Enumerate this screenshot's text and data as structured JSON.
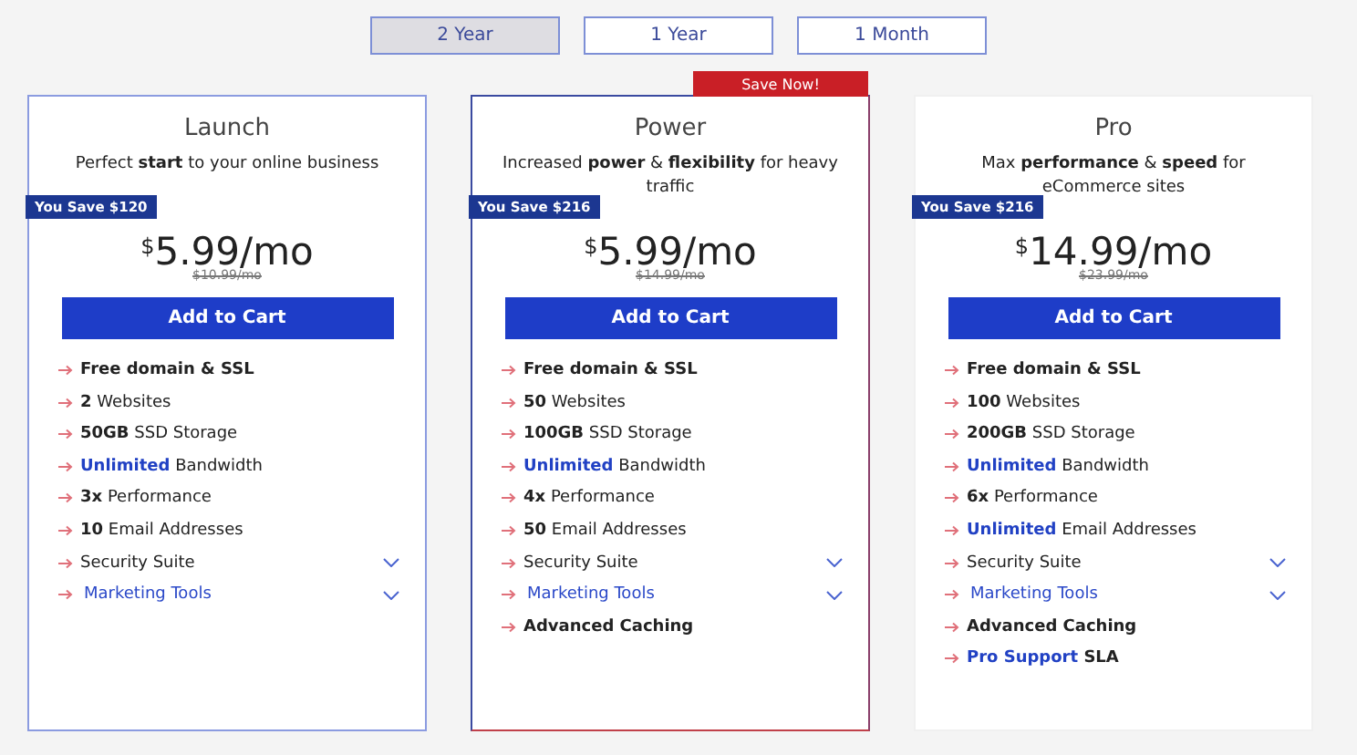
{
  "billing_periods": [
    {
      "label": "2 Year",
      "selected": true
    },
    {
      "label": "1 Year",
      "selected": false
    },
    {
      "label": "1 Month",
      "selected": false
    }
  ],
  "plans": [
    {
      "name": "Launch",
      "kind": "outline",
      "tagline": "Perfect **start** to your online business",
      "savings": "You Save $120",
      "currency": "$",
      "price": "5.99/mo",
      "old_price": "$10.99/mo",
      "button": "Add to Cart",
      "features": [
        {
          "text": "Free domain & SSL",
          "kind": "plain",
          "bold": true,
          "expandable": false
        },
        {
          "text": "**2** Websites",
          "kind": "plain",
          "bold": false,
          "expandable": false
        },
        {
          "text": "**50GB** SSD Storage",
          "kind": "plain",
          "bold": false,
          "expandable": false
        },
        {
          "text": "**Unlimited** Bandwidth",
          "kind": "accent",
          "bold": false,
          "expandable": false
        },
        {
          "text": "**3x** Performance",
          "kind": "plain",
          "bold": false,
          "expandable": false
        },
        {
          "text": "**10** Email Addresses",
          "kind": "plain",
          "bold": false,
          "expandable": false
        },
        {
          "text": "Security Suite",
          "kind": "plain",
          "bold": false,
          "expandable": true
        },
        {
          "text": "Marketing Tools",
          "kind": "link",
          "bold": false,
          "expandable": true
        }
      ]
    },
    {
      "name": "Power",
      "kind": "featured",
      "ribbon": "Save Now!",
      "tagline": "Increased **power** & **flexibility** for heavy traffic",
      "savings": "You Save $216",
      "currency": "$",
      "price": "5.99/mo",
      "old_price": "$14.99/mo",
      "button": "Add to Cart",
      "features": [
        {
          "text": "Free domain & SSL",
          "kind": "plain",
          "bold": true,
          "expandable": false
        },
        {
          "text": "**50** Websites",
          "kind": "plain",
          "bold": false,
          "expandable": false
        },
        {
          "text": "**100GB** SSD Storage",
          "kind": "plain",
          "bold": false,
          "expandable": false
        },
        {
          "text": "**Unlimited** Bandwidth",
          "kind": "accent",
          "bold": false,
          "expandable": false
        },
        {
          "text": "**4x** Performance",
          "kind": "plain",
          "bold": false,
          "expandable": false
        },
        {
          "text": "**50** Email Addresses",
          "kind": "plain",
          "bold": false,
          "expandable": false
        },
        {
          "text": "Security Suite",
          "kind": "plain",
          "bold": false,
          "expandable": true
        },
        {
          "text": "Marketing Tools",
          "kind": "link",
          "bold": false,
          "expandable": true
        },
        {
          "text": "Advanced Caching",
          "kind": "plain",
          "bold": true,
          "expandable": false
        }
      ]
    },
    {
      "name": "Pro",
      "kind": "plain",
      "tagline": "Max **performance** & **speed** for eCommerce sites",
      "savings": "You Save $216",
      "currency": "$",
      "price": "14.99/mo",
      "old_price": "$23.99/mo",
      "button": "Add to Cart",
      "features": [
        {
          "text": "Free domain & SSL",
          "kind": "plain",
          "bold": true,
          "expandable": false
        },
        {
          "text": "**100** Websites",
          "kind": "plain",
          "bold": false,
          "expandable": false
        },
        {
          "text": "**200GB** SSD Storage",
          "kind": "plain",
          "bold": false,
          "expandable": false
        },
        {
          "text": "**Unlimited** Bandwidth",
          "kind": "accent",
          "bold": false,
          "expandable": false
        },
        {
          "text": "**6x** Performance",
          "kind": "plain",
          "bold": false,
          "expandable": false
        },
        {
          "text": "**Unlimited** Email Addresses",
          "kind": "accent",
          "bold": false,
          "expandable": false
        },
        {
          "text": "Security Suite",
          "kind": "plain",
          "bold": false,
          "expandable": true
        },
        {
          "text": "Marketing Tools",
          "kind": "link",
          "bold": false,
          "expandable": true
        },
        {
          "text": "Advanced Caching",
          "kind": "plain",
          "bold": true,
          "expandable": false
        },
        {
          "text": "**Pro Support** SLA",
          "kind": "accent",
          "bold": true,
          "expandable": false
        }
      ]
    }
  ]
}
